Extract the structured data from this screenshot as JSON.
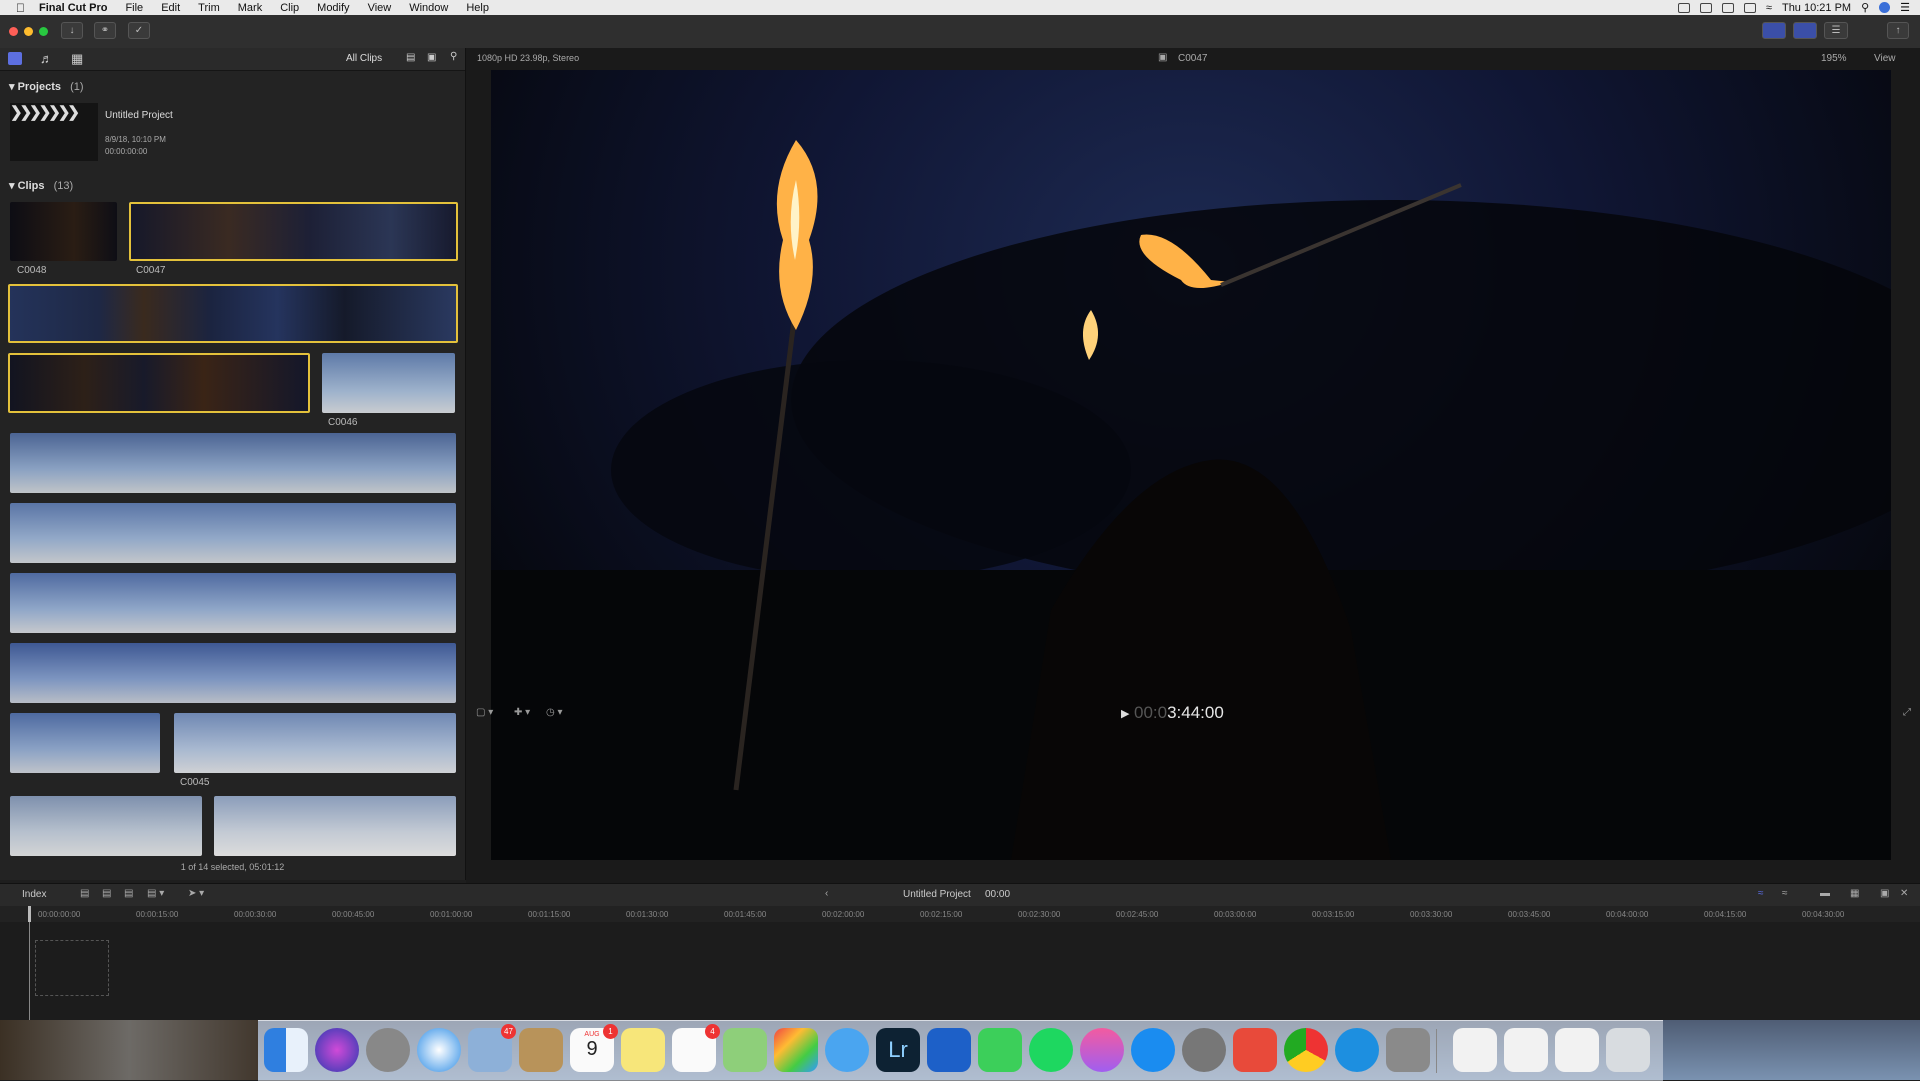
{
  "menubar": {
    "app_name": "Final Cut Pro",
    "items": [
      "File",
      "Edit",
      "Trim",
      "Mark",
      "Clip",
      "Modify",
      "View",
      "Window",
      "Help"
    ],
    "clock": "Thu 10:21 PM"
  },
  "browser": {
    "filter_label": "All Clips",
    "projects_title": "Projects",
    "projects_count": "(1)",
    "project": {
      "name": "Untitled Project",
      "date": "8/9/18, 10:10 PM",
      "duration": "00:00:00:00"
    },
    "clips_title": "Clips",
    "clips_count": "(13)",
    "clip_labels": {
      "c1": "C0048",
      "c2": "C0047",
      "c3": "C0046",
      "c4": "C0045"
    },
    "status": "1 of 14 selected, 05:01:12"
  },
  "viewer": {
    "format": "1080p HD 23.98p, Stereo",
    "clip_name": "C0047",
    "zoom": "195%",
    "view_label": "View",
    "timecode_dim": "00:0",
    "timecode": "3:44:00"
  },
  "timeline": {
    "index_label": "Index",
    "project_name": "Untitled Project",
    "duration": "00:00",
    "ruler": [
      "00:00:00:00",
      "00:00:15:00",
      "00:00:30:00",
      "00:00:45:00",
      "00:01:00:00",
      "00:01:15:00",
      "00:01:30:00",
      "00:01:45:00",
      "00:02:00:00",
      "00:02:15:00",
      "00:02:30:00",
      "00:02:45:00",
      "00:03:00:00",
      "00:03:15:00",
      "00:03:30:00",
      "00:03:45:00",
      "00:04:00:00",
      "00:04:15:00",
      "00:04:30:00"
    ]
  },
  "dock": {
    "badges": {
      "mail": "47",
      "calendar": "1",
      "reminders": "4"
    },
    "calendar_day": "9",
    "calendar_month": "AUG",
    "lr_label": "Lr"
  }
}
